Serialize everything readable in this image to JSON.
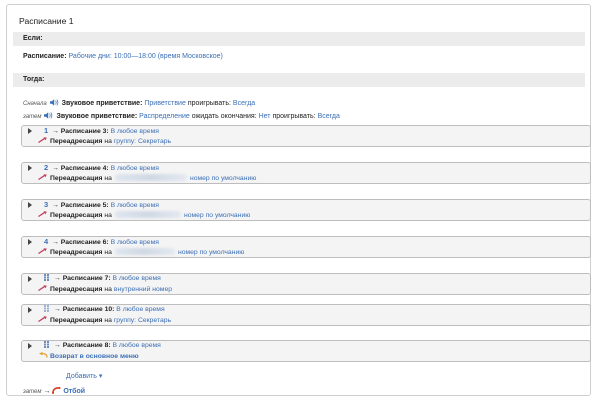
{
  "schedule_title": "Расписание 1",
  "if_label": "Если:",
  "condition": {
    "label": "Расписание:",
    "value": "Рабочие дни: 10:00—18:00",
    "tz": "(время Московское)"
  },
  "then_label": "Тогда:",
  "actions": [
    {
      "prefix": "Сначала",
      "label": "Звуковое приветствие:",
      "link": "Приветствие",
      "mid": "проигрывать:",
      "link2": "Всегда"
    },
    {
      "prefix": "затем",
      "label": "Звуковое приветствие:",
      "link": "Распределение",
      "mid": "ожидать окончания:",
      "link2": "Нет",
      "mid2": "проигрывать:",
      "link3": "Всегда"
    }
  ],
  "rules": [
    {
      "num": "1",
      "arrow": "→",
      "sched": "Расписание 3:",
      "time": "В любое время",
      "act": "Переадресация",
      "pre": "на",
      "target": "группу: Секретарь",
      "suffix": ""
    },
    {
      "num": "2",
      "arrow": "→",
      "sched": "Расписание 4:",
      "time": "В любое время",
      "act": "Переадресация",
      "pre": "на",
      "target": "",
      "suffix": "номер по умолчанию"
    },
    {
      "num": "3",
      "arrow": "→",
      "sched": "Расписание 5:",
      "time": "В любое время",
      "act": "Переадресация",
      "pre": "на",
      "target": "",
      "suffix": "номер по умолчанию"
    },
    {
      "num": "4",
      "arrow": "→",
      "sched": "Расписание 6:",
      "time": "В любое время",
      "act": "Переадресация",
      "pre": "на",
      "target": "",
      "suffix": "номер по умолчанию"
    },
    {
      "num": "",
      "arrow": "→",
      "sched": "Расписание 7:",
      "time": "В любое время",
      "act": "Переадресация",
      "pre": "на",
      "target": "внутренний номер",
      "suffix": ""
    },
    {
      "num": "",
      "arrow": "→",
      "sched": "Расписание 10:",
      "time": "В любое время",
      "act": "Переадресация",
      "pre": "на",
      "target": "группу: Секретарь",
      "suffix": ""
    },
    {
      "num": "",
      "arrow": "→",
      "sched": "Расписание 8:",
      "time": "В любое время",
      "act": "Возврат в основное меню",
      "pre": "",
      "target": "",
      "suffix": ""
    }
  ],
  "add_label": "Добавить ▾",
  "final": {
    "prefix": "затем",
    "arrow": "→",
    "label": "Отбой"
  },
  "colors": {
    "link": "#3b6fb6",
    "band": "#ececec",
    "rule_bg": "#f4f4f4",
    "hangup": "#d9381e",
    "return": "#e8a33a"
  }
}
